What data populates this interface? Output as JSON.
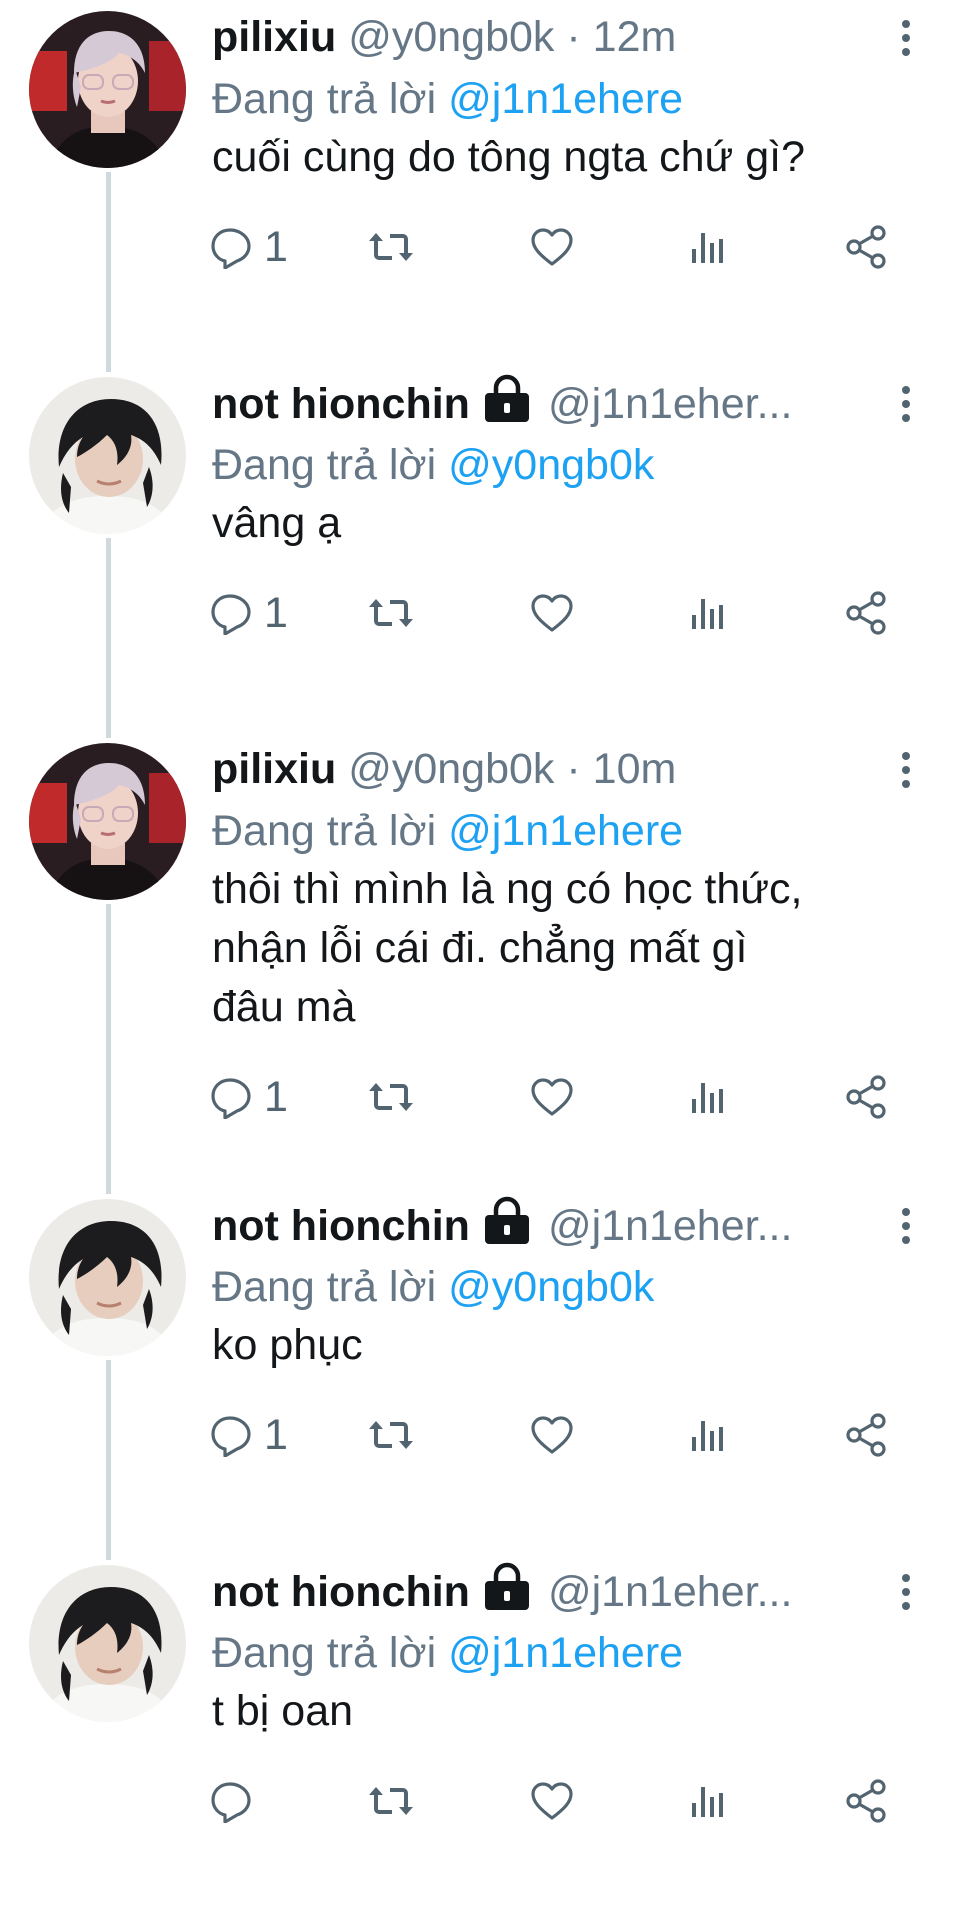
{
  "labels": {
    "replying_to": "Đang trả lời",
    "dot": "·"
  },
  "colors": {
    "mention": "#1da1f2",
    "secondary": "#657786",
    "rail": "#cfd9de"
  },
  "tweets": [
    {
      "name": "pilixiu",
      "handle": "@y0ngb0k",
      "time": "12m",
      "locked": false,
      "reply_to": "@j1n1ehere",
      "lines": [
        "cuối cùng do tông ngta chứ gì?"
      ],
      "reply_count": "1",
      "avatar": "avatar-pilixiu"
    },
    {
      "name": "not hionchin",
      "handle": "@j1n1eher...",
      "time": "",
      "locked": true,
      "reply_to": "@y0ngb0k",
      "lines": [
        "vâng ạ"
      ],
      "reply_count": "1",
      "avatar": "avatar-hionchin"
    },
    {
      "name": "pilixiu",
      "handle": "@y0ngb0k",
      "time": "10m",
      "locked": false,
      "reply_to": "@j1n1ehere",
      "lines": [
        "thôi thì mình là ng có học thức,",
        "nhận lỗi cái đi. chẳng mất gì",
        "đâu mà"
      ],
      "reply_count": "1",
      "avatar": "avatar-pilixiu"
    },
    {
      "name": "not hionchin",
      "handle": "@j1n1eher...",
      "time": "",
      "locked": true,
      "reply_to": "@y0ngb0k",
      "lines": [
        "ko phục"
      ],
      "reply_count": "1",
      "avatar": "avatar-hionchin"
    },
    {
      "name": "not hionchin",
      "handle": "@j1n1eher...",
      "time": "",
      "locked": true,
      "reply_to": "@j1n1ehere",
      "lines": [
        "t bị oan"
      ],
      "reply_count": "",
      "avatar": "avatar-hionchin"
    }
  ]
}
